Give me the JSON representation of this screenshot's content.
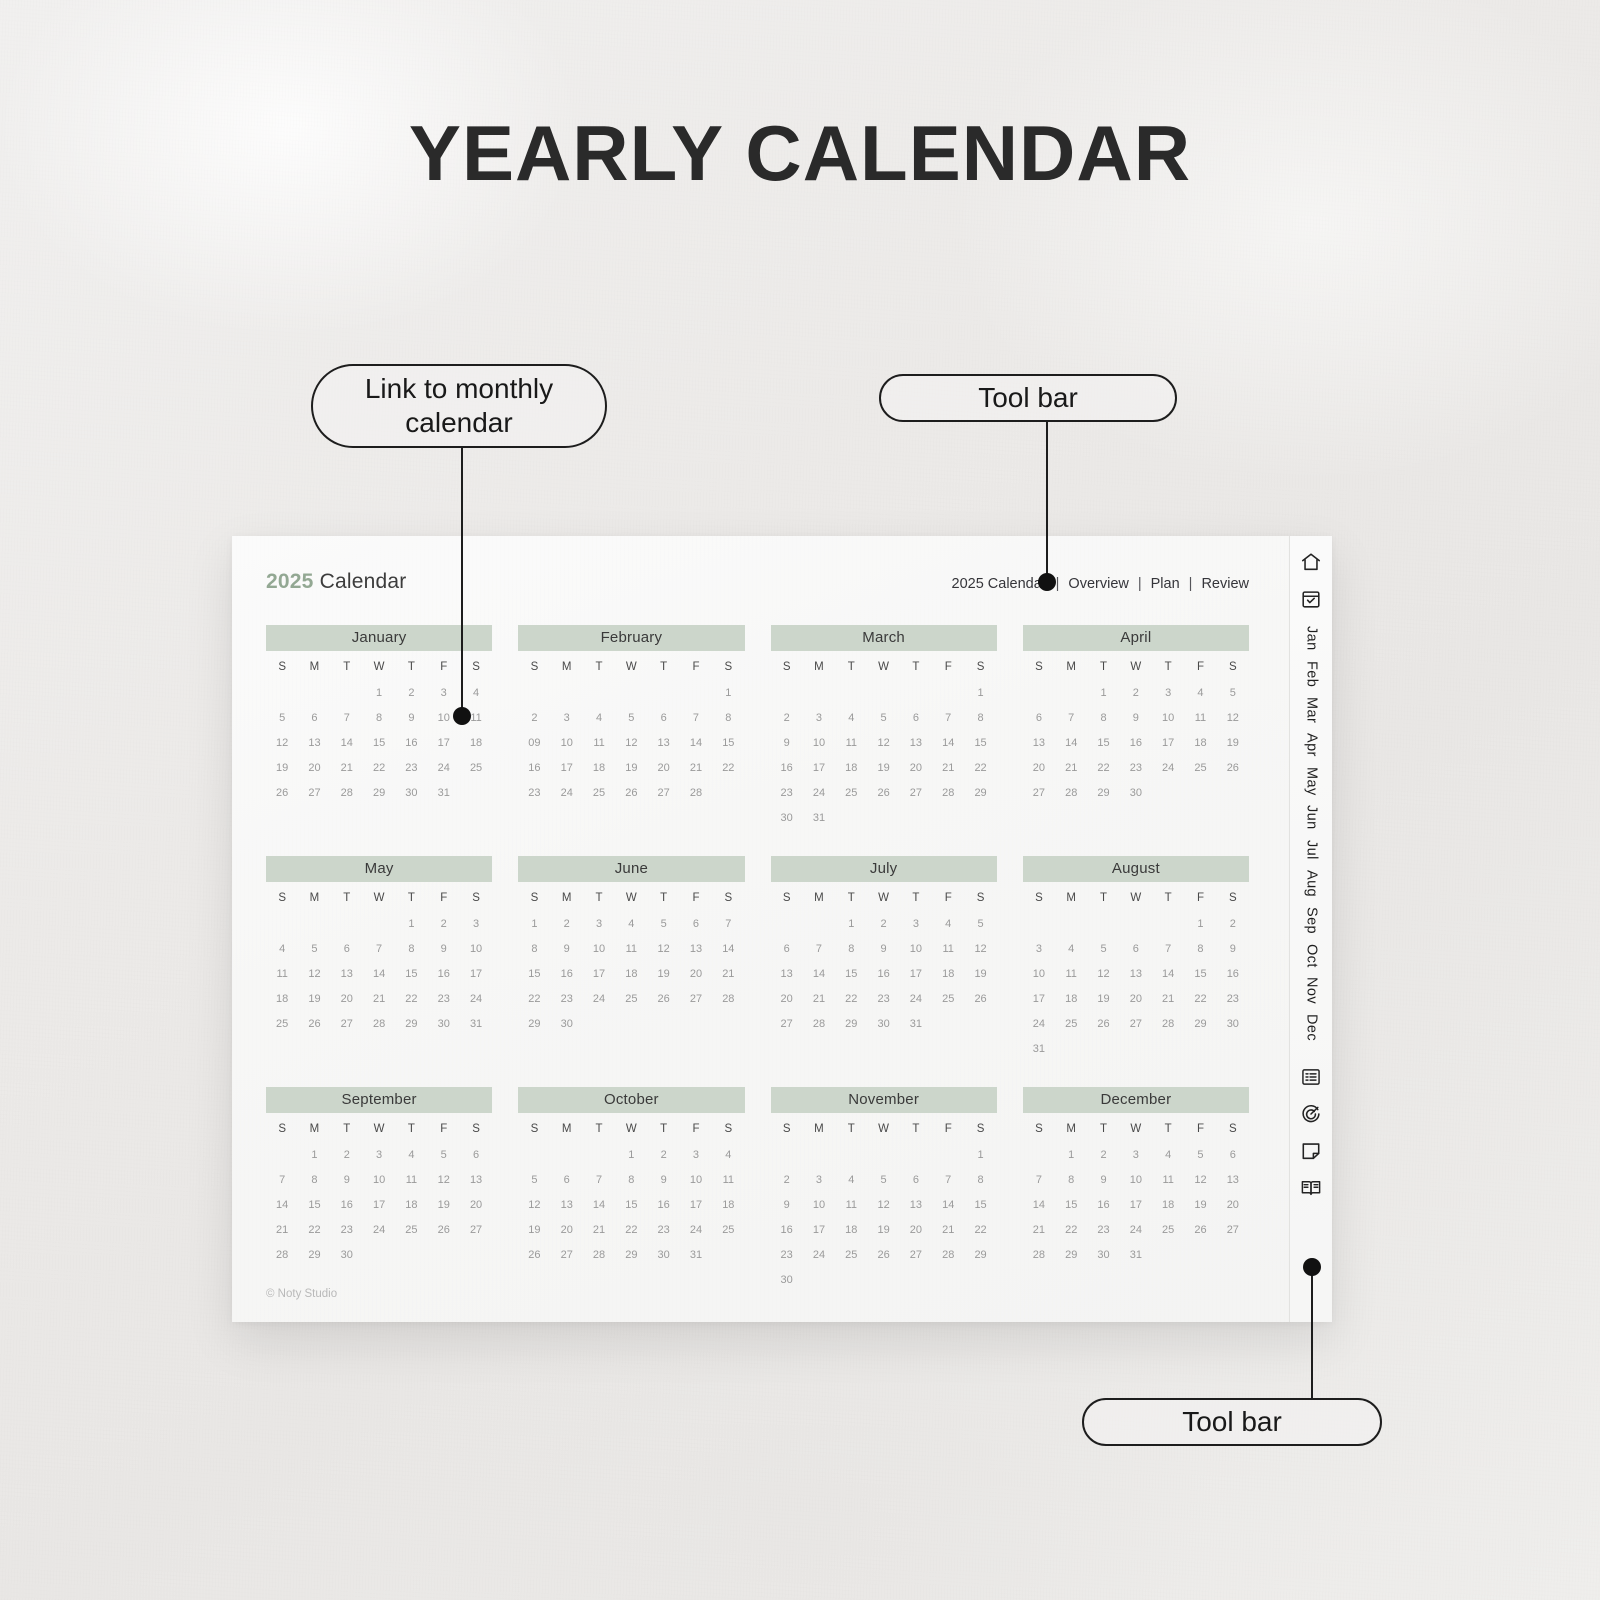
{
  "page": {
    "title": "YEARLY CALENDAR"
  },
  "callouts": [
    {
      "id": "monthly",
      "label": "Link to monthly calendar"
    },
    {
      "id": "toolbar_top",
      "label": "Tool bar"
    },
    {
      "id": "toolbar_bottom",
      "label": "Tool bar"
    }
  ],
  "sheet": {
    "doc_title": {
      "year": "2025",
      "word": "Calendar"
    },
    "top_nav": {
      "items": [
        "2025 Calendar",
        "Overview",
        "Plan",
        "Review"
      ],
      "separator": "|"
    },
    "footer": "© Noty Studio",
    "weekday_headers": [
      "S",
      "M",
      "T",
      "W",
      "T",
      "F",
      "S"
    ],
    "colors": {
      "month_header_bg": "#ccd6cb",
      "year_accent": "#93a893",
      "day_text": "#9a9a9a",
      "sheet_bg": "#f8f8f7"
    },
    "months": [
      {
        "name": "January",
        "weeks": [
          [
            "",
            "",
            "",
            "1",
            "2",
            "3",
            "4"
          ],
          [
            "5",
            "6",
            "7",
            "8",
            "9",
            "10",
            "11"
          ],
          [
            "12",
            "13",
            "14",
            "15",
            "16",
            "17",
            "18"
          ],
          [
            "19",
            "20",
            "21",
            "22",
            "23",
            "24",
            "25"
          ],
          [
            "26",
            "27",
            "28",
            "29",
            "30",
            "31",
            ""
          ]
        ]
      },
      {
        "name": "February",
        "weeks": [
          [
            "",
            "",
            "",
            "",
            "",
            "",
            "1"
          ],
          [
            "2",
            "3",
            "4",
            "5",
            "6",
            "7",
            "8"
          ],
          [
            "09",
            "10",
            "11",
            "12",
            "13",
            "14",
            "15"
          ],
          [
            "16",
            "17",
            "18",
            "19",
            "20",
            "21",
            "22"
          ],
          [
            "23",
            "24",
            "25",
            "26",
            "27",
            "28",
            ""
          ]
        ]
      },
      {
        "name": "March",
        "weeks": [
          [
            "",
            "",
            "",
            "",
            "",
            "",
            "1"
          ],
          [
            "2",
            "3",
            "4",
            "5",
            "6",
            "7",
            "8"
          ],
          [
            "9",
            "10",
            "11",
            "12",
            "13",
            "14",
            "15"
          ],
          [
            "16",
            "17",
            "18",
            "19",
            "20",
            "21",
            "22"
          ],
          [
            "23",
            "24",
            "25",
            "26",
            "27",
            "28",
            "29"
          ],
          [
            "30",
            "31",
            "",
            "",
            "",
            "",
            ""
          ]
        ]
      },
      {
        "name": "April",
        "weeks": [
          [
            "",
            "",
            "1",
            "2",
            "3",
            "4",
            "5"
          ],
          [
            "6",
            "7",
            "8",
            "9",
            "10",
            "11",
            "12"
          ],
          [
            "13",
            "14",
            "15",
            "16",
            "17",
            "18",
            "19"
          ],
          [
            "20",
            "21",
            "22",
            "23",
            "24",
            "25",
            "26"
          ],
          [
            "27",
            "28",
            "29",
            "30",
            "",
            "",
            ""
          ]
        ]
      },
      {
        "name": "May",
        "weeks": [
          [
            "",
            "",
            "",
            "",
            "1",
            "2",
            "3"
          ],
          [
            "4",
            "5",
            "6",
            "7",
            "8",
            "9",
            "10"
          ],
          [
            "11",
            "12",
            "13",
            "14",
            "15",
            "16",
            "17"
          ],
          [
            "18",
            "19",
            "20",
            "21",
            "22",
            "23",
            "24"
          ],
          [
            "25",
            "26",
            "27",
            "28",
            "29",
            "30",
            "31"
          ]
        ]
      },
      {
        "name": "June",
        "weeks": [
          [
            "1",
            "2",
            "3",
            "4",
            "5",
            "6",
            "7"
          ],
          [
            "8",
            "9",
            "10",
            "11",
            "12",
            "13",
            "14"
          ],
          [
            "15",
            "16",
            "17",
            "18",
            "19",
            "20",
            "21"
          ],
          [
            "22",
            "23",
            "24",
            "25",
            "26",
            "27",
            "28"
          ],
          [
            "29",
            "30",
            "",
            "",
            "",
            "",
            ""
          ]
        ]
      },
      {
        "name": "July",
        "weeks": [
          [
            "",
            "",
            "1",
            "2",
            "3",
            "4",
            "5"
          ],
          [
            "6",
            "7",
            "8",
            "9",
            "10",
            "11",
            "12"
          ],
          [
            "13",
            "14",
            "15",
            "16",
            "17",
            "18",
            "19"
          ],
          [
            "20",
            "21",
            "22",
            "23",
            "24",
            "25",
            "26"
          ],
          [
            "27",
            "28",
            "29",
            "30",
            "31",
            "",
            ""
          ]
        ]
      },
      {
        "name": "August",
        "weeks": [
          [
            "",
            "",
            "",
            "",
            "",
            "1",
            "2"
          ],
          [
            "3",
            "4",
            "5",
            "6",
            "7",
            "8",
            "9"
          ],
          [
            "10",
            "11",
            "12",
            "13",
            "14",
            "15",
            "16"
          ],
          [
            "17",
            "18",
            "19",
            "20",
            "21",
            "22",
            "23"
          ],
          [
            "24",
            "25",
            "26",
            "27",
            "28",
            "29",
            "30"
          ],
          [
            "31",
            "",
            "",
            "",
            "",
            "",
            ""
          ]
        ]
      },
      {
        "name": "September",
        "weeks": [
          [
            "",
            "1",
            "2",
            "3",
            "4",
            "5",
            "6"
          ],
          [
            "7",
            "8",
            "9",
            "10",
            "11",
            "12",
            "13"
          ],
          [
            "14",
            "15",
            "16",
            "17",
            "18",
            "19",
            "20"
          ],
          [
            "21",
            "22",
            "23",
            "24",
            "25",
            "26",
            "27"
          ],
          [
            "28",
            "29",
            "30",
            "",
            "",
            "",
            ""
          ]
        ]
      },
      {
        "name": "October",
        "weeks": [
          [
            "",
            "",
            "",
            "1",
            "2",
            "3",
            "4"
          ],
          [
            "5",
            "6",
            "7",
            "8",
            "9",
            "10",
            "11"
          ],
          [
            "12",
            "13",
            "14",
            "15",
            "16",
            "17",
            "18"
          ],
          [
            "19",
            "20",
            "21",
            "22",
            "23",
            "24",
            "25"
          ],
          [
            "26",
            "27",
            "28",
            "29",
            "30",
            "31",
            ""
          ]
        ]
      },
      {
        "name": "November",
        "weeks": [
          [
            "",
            "",
            "",
            "",
            "",
            "",
            "1"
          ],
          [
            "2",
            "3",
            "4",
            "5",
            "6",
            "7",
            "8"
          ],
          [
            "9",
            "10",
            "11",
            "12",
            "13",
            "14",
            "15"
          ],
          [
            "16",
            "17",
            "18",
            "19",
            "20",
            "21",
            "22"
          ],
          [
            "23",
            "24",
            "25",
            "26",
            "27",
            "28",
            "29"
          ],
          [
            "30",
            "",
            "",
            "",
            "",
            "",
            ""
          ]
        ]
      },
      {
        "name": "December",
        "weeks": [
          [
            "",
            "1",
            "2",
            "3",
            "4",
            "5",
            "6"
          ],
          [
            "7",
            "8",
            "9",
            "10",
            "11",
            "12",
            "13"
          ],
          [
            "14",
            "15",
            "16",
            "17",
            "18",
            "19",
            "20"
          ],
          [
            "21",
            "22",
            "23",
            "24",
            "25",
            "26",
            "27"
          ],
          [
            "28",
            "29",
            "30",
            "31",
            "",
            "",
            ""
          ]
        ]
      }
    ]
  },
  "toolbar": {
    "top_icons": [
      {
        "icon": "home-icon",
        "label": "Home"
      },
      {
        "icon": "calendar-check-icon",
        "label": "Calendar"
      }
    ],
    "months": [
      "Jan",
      "Feb",
      "Mar",
      "Apr",
      "May",
      "Jun",
      "Jul",
      "Aug",
      "Sep",
      "Oct",
      "Nov",
      "Dec"
    ],
    "bottom_icons": [
      {
        "icon": "notes-list-icon",
        "label": "Notes"
      },
      {
        "icon": "target-goal-icon",
        "label": "Goals"
      },
      {
        "icon": "sticky-note-icon",
        "label": "Sticky Note"
      },
      {
        "icon": "open-book-icon",
        "label": "Journal"
      }
    ]
  }
}
